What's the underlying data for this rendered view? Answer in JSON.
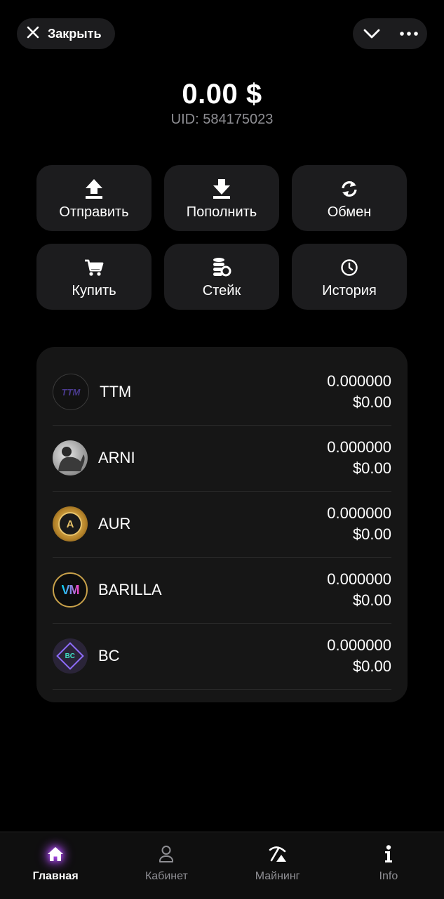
{
  "header": {
    "close_label": "Закрыть",
    "close_icon": "close-icon",
    "collapse_icon": "chevron-down-icon",
    "more_icon": "more-dots-icon"
  },
  "balance": {
    "amount": "0.00 $",
    "uid": "UID: 584175023"
  },
  "actions": [
    {
      "label": "Отправить",
      "icon": "upload-icon"
    },
    {
      "label": "Пополнить",
      "icon": "download-icon"
    },
    {
      "label": "Обмен",
      "icon": "exchange-icon"
    },
    {
      "label": "Купить",
      "icon": "cart-icon"
    },
    {
      "label": "Стейк",
      "icon": "coins-stack-icon"
    },
    {
      "label": "История",
      "icon": "clock-icon"
    }
  ],
  "assets": [
    {
      "symbol": "TTM",
      "amount": "0.000000",
      "usd": "$0.00",
      "logo_text": "TTM"
    },
    {
      "symbol": "ARNI",
      "amount": "0.000000",
      "usd": "$0.00"
    },
    {
      "symbol": "AUR",
      "amount": "0.000000",
      "usd": "$0.00",
      "logo_text": "A"
    },
    {
      "symbol": "BARILLA",
      "amount": "0.000000",
      "usd": "$0.00",
      "logo_text": "VM"
    },
    {
      "symbol": "BC",
      "amount": "0.000000",
      "usd": "$0.00",
      "logo_text": "BC"
    }
  ],
  "nav": [
    {
      "label": "Главная",
      "icon": "home-icon",
      "active": true
    },
    {
      "label": "Кабинет",
      "icon": "user-icon",
      "active": false
    },
    {
      "label": "Майнинг",
      "icon": "pickaxe-icon",
      "active": false
    },
    {
      "label": "Info",
      "icon": "info-icon",
      "active": false
    }
  ],
  "colors": {
    "background": "#000000",
    "card": "#1c1c1e",
    "panel": "#161616",
    "muted_text": "#8e8e93",
    "accent_glow": "#b54bff"
  }
}
